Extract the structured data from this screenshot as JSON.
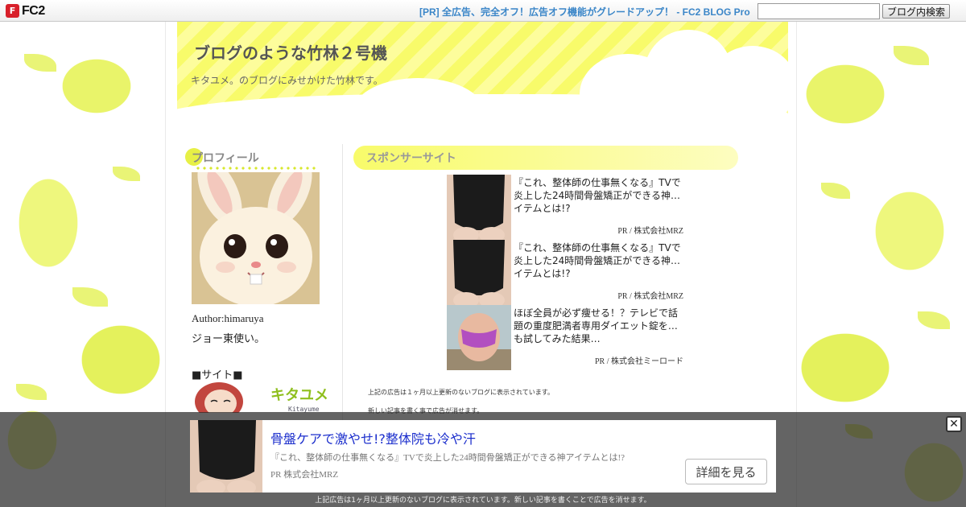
{
  "topbar": {
    "logo_text": "FC2",
    "pr_link": "[PR] 全広告、完全オフ！広告オフ機能がグレードアップ！ - FC2 BLOG Pro",
    "search_value": "",
    "search_button": "ブログ内検索"
  },
  "header": {
    "title": "ブログのような竹林２号機",
    "description": "キタユメ。のブログにみせかけた竹林です。"
  },
  "sidebar": {
    "profile_heading": "プロフィール",
    "author": "Author:himaruya",
    "author_desc": "ジョー東使い。",
    "site_heading": "■サイト■",
    "banner_text": "キタユメ",
    "banner_sub": "Kitayume"
  },
  "main": {
    "sponsor_heading": "スポンサーサイト",
    "ads": [
      {
        "text": "『これ、整体師の仕事無くなる』TVで炎上した24時間骨盤矯正ができる神…イテムとは!?",
        "sponsor": "PR / 株式会社MRZ"
      },
      {
        "text": "『これ、整体師の仕事無くなる』TVで炎上した24時間骨盤矯正ができる神…イテムとは!?",
        "sponsor": "PR / 株式会社MRZ"
      },
      {
        "text": "ほぼ全員が必ず痩せる！？テレビで話題の重度肥満者専用ダイエット錠を…も試してみた結果…",
        "sponsor": "PR / 株式会社ミーロード"
      }
    ],
    "notice_1": "上記の広告は１ヶ月以上更新のないブログに表示されています。",
    "notice_2": "新しい記事を書く事で広告が消せます。"
  },
  "overlay": {
    "close_symbol": "✕",
    "title": "骨盤ケアで激やせ!?整体院も冷や汗",
    "desc": "『これ、整体師の仕事無くなる』TVで炎上した24時間骨盤矯正ができる神アイテムとは!?",
    "sponsor": "PR  株式会社MRZ",
    "button": "詳細を見る",
    "notice": "上記広告は1ヶ月以上更新のないブログに表示されています。新しい記事を書くことで広告を消せます。"
  },
  "colors": {
    "header_yellow": "#f8fb6a",
    "link_blue": "#3b86c8",
    "ad_title_blue": "#1a2dcc"
  }
}
